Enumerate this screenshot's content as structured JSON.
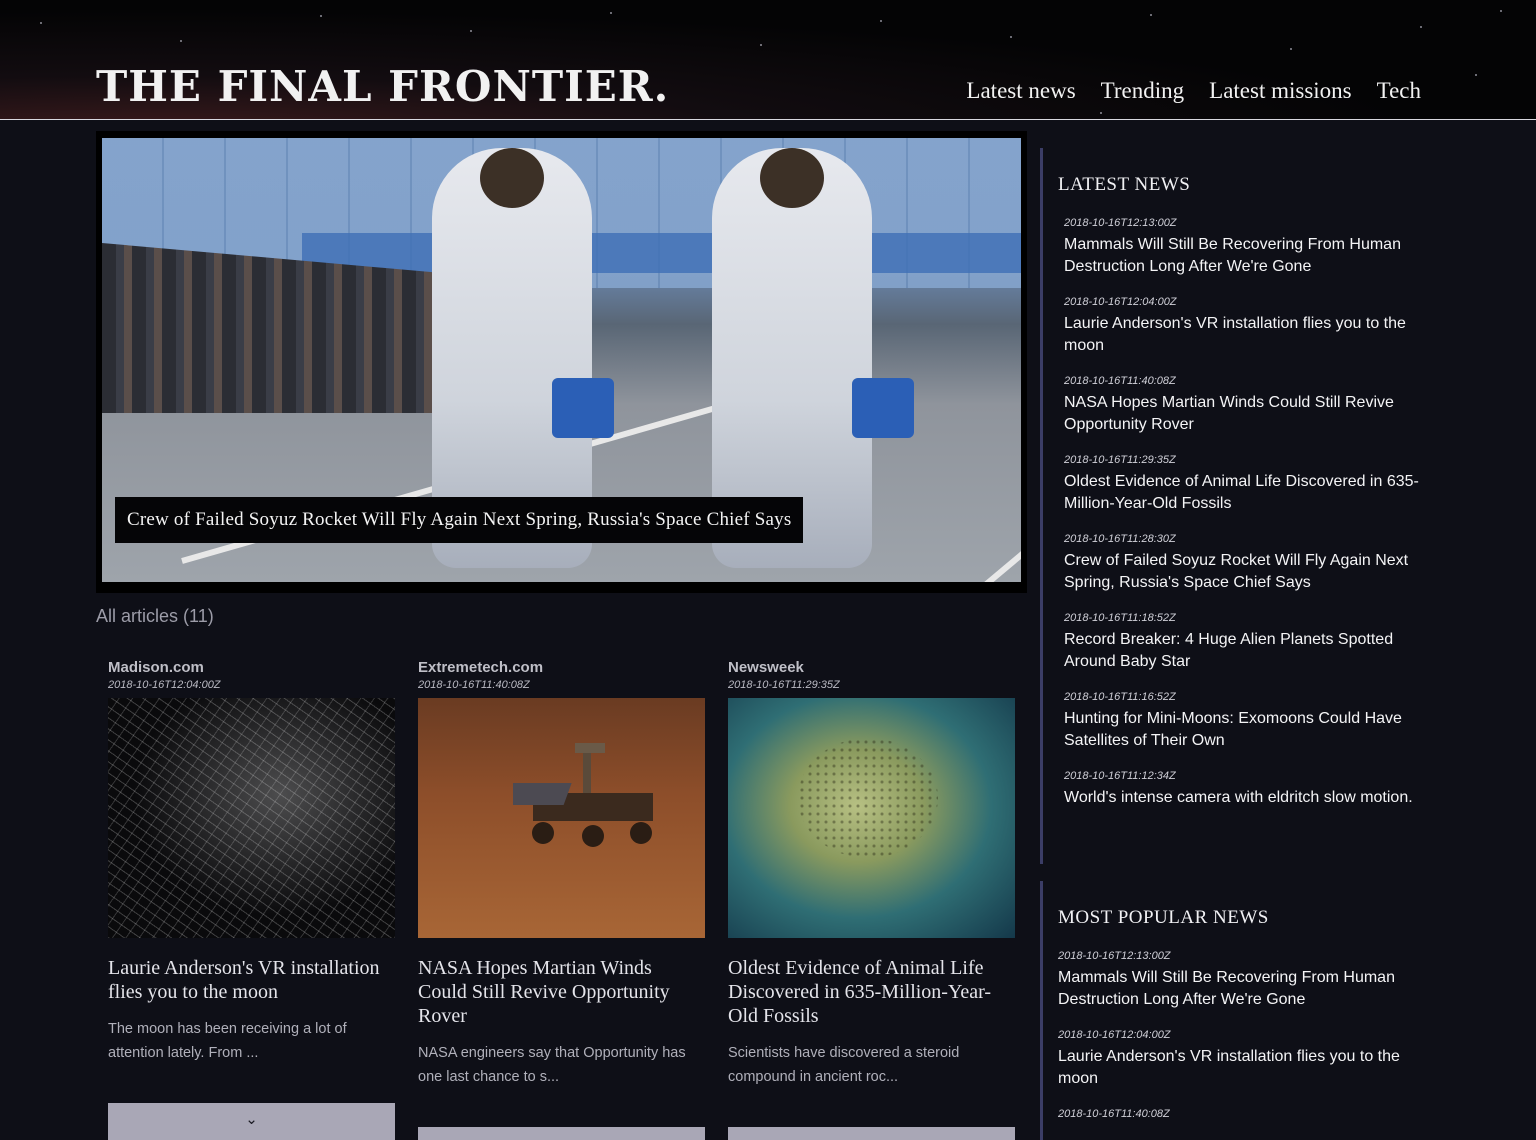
{
  "header": {
    "logo": "THE FINAL FRONTIER.",
    "nav": [
      "Latest news",
      "Trending",
      "Latest missions",
      "Tech"
    ]
  },
  "hero": {
    "caption": "Crew of Failed Soyuz Rocket Will Fly Again Next Spring, Russia's Space Chief Says"
  },
  "main": {
    "all_articles_label": "All articles (11)"
  },
  "cards": [
    {
      "source": "Madison.com",
      "date": "2018-10-16T12:04:00Z",
      "title": "Laurie Anderson's VR installation flies you to the moon",
      "excerpt": "The moon has been receiving a lot of attention lately. From ...",
      "more": "⌄"
    },
    {
      "source": "Extremetech.com",
      "date": "2018-10-16T11:40:08Z",
      "title": "NASA Hopes Martian Winds Could Still Revive Opportunity Rover",
      "excerpt": "NASA engineers say that Opportunity has one last chance to s...",
      "more": "⌄"
    },
    {
      "source": "Newsweek",
      "date": "2018-10-16T11:29:35Z",
      "title": "Oldest Evidence of Animal Life Discovered in 635-Million-Year-Old Fossils",
      "excerpt": "Scientists have discovered a steroid compound in ancient roc...",
      "more": "⌄"
    }
  ],
  "sidebar": {
    "latest": {
      "heading": "LATEST NEWS",
      "items": [
        {
          "date": "2018-10-16T12:13:00Z",
          "title": "Mammals Will Still Be Recovering From Human Destruction Long After We're Gone"
        },
        {
          "date": "2018-10-16T12:04:00Z",
          "title": "Laurie Anderson's VR installation flies you to the moon"
        },
        {
          "date": "2018-10-16T11:40:08Z",
          "title": "NASA Hopes Martian Winds Could Still Revive Opportunity Rover"
        },
        {
          "date": "2018-10-16T11:29:35Z",
          "title": "Oldest Evidence of Animal Life Discovered in 635-Million-Year-Old Fossils"
        },
        {
          "date": "2018-10-16T11:28:30Z",
          "title": "Crew of Failed Soyuz Rocket Will Fly Again Next Spring, Russia's Space Chief Says"
        },
        {
          "date": "2018-10-16T11:18:52Z",
          "title": "Record Breaker: 4 Huge Alien Planets Spotted Around Baby Star"
        },
        {
          "date": "2018-10-16T11:16:52Z",
          "title": "Hunting for Mini-Moons: Exomoons Could Have Satellites of Their Own"
        },
        {
          "date": "2018-10-16T11:12:34Z",
          "title": "World's intense camera with eldritch slow motion."
        }
      ]
    },
    "popular": {
      "heading": "MOST POPULAR NEWS",
      "items": [
        {
          "date": "2018-10-16T12:13:00Z",
          "title": "Mammals Will Still Be Recovering From Human Destruction Long After We're Gone"
        },
        {
          "date": "2018-10-16T12:04:00Z",
          "title": "Laurie Anderson's VR installation flies you to the moon"
        },
        {
          "date": "2018-10-16T11:40:08Z",
          "title": ""
        }
      ]
    }
  },
  "colors": {
    "background": "#0e0f17",
    "sidebar_rule": "#3b3d66",
    "more_button": "#a9a7b6"
  }
}
